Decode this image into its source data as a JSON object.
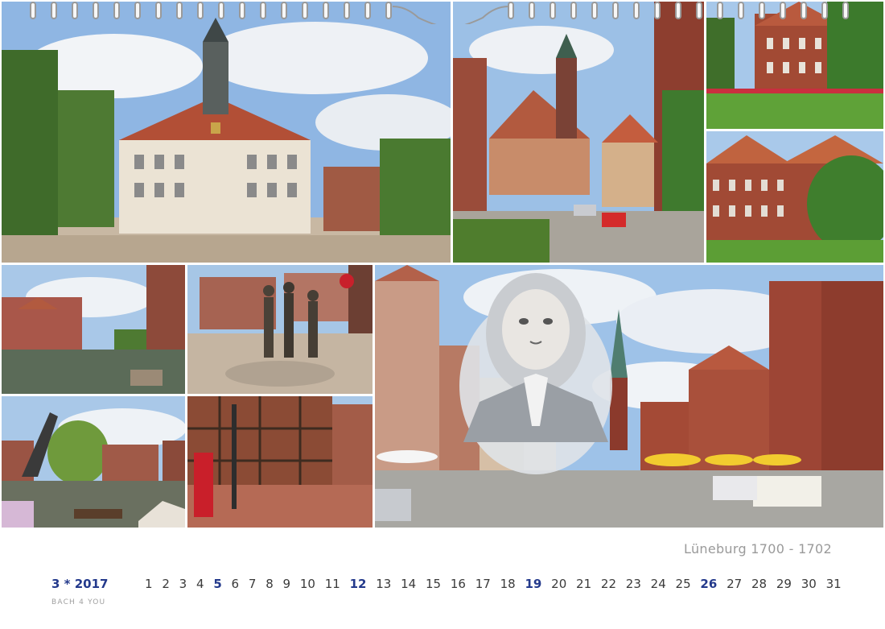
{
  "caption": "Lüneburg 1700 - 1702",
  "month_label": "3 * 2017",
  "brand": "BACH 4 YOU",
  "days": [
    "1",
    "2",
    "3",
    "4",
    "5",
    "6",
    "7",
    "8",
    "9",
    "10",
    "11",
    "12",
    "13",
    "14",
    "15",
    "16",
    "17",
    "18",
    "19",
    "20",
    "21",
    "22",
    "23",
    "24",
    "25",
    "26",
    "27",
    "28",
    "29",
    "30",
    "31"
  ],
  "sundays": [
    "5",
    "12",
    "19",
    "26"
  ],
  "colors": {
    "accent": "#243a8c",
    "caption": "#9a9a9a",
    "text": "#3a3a3a"
  }
}
